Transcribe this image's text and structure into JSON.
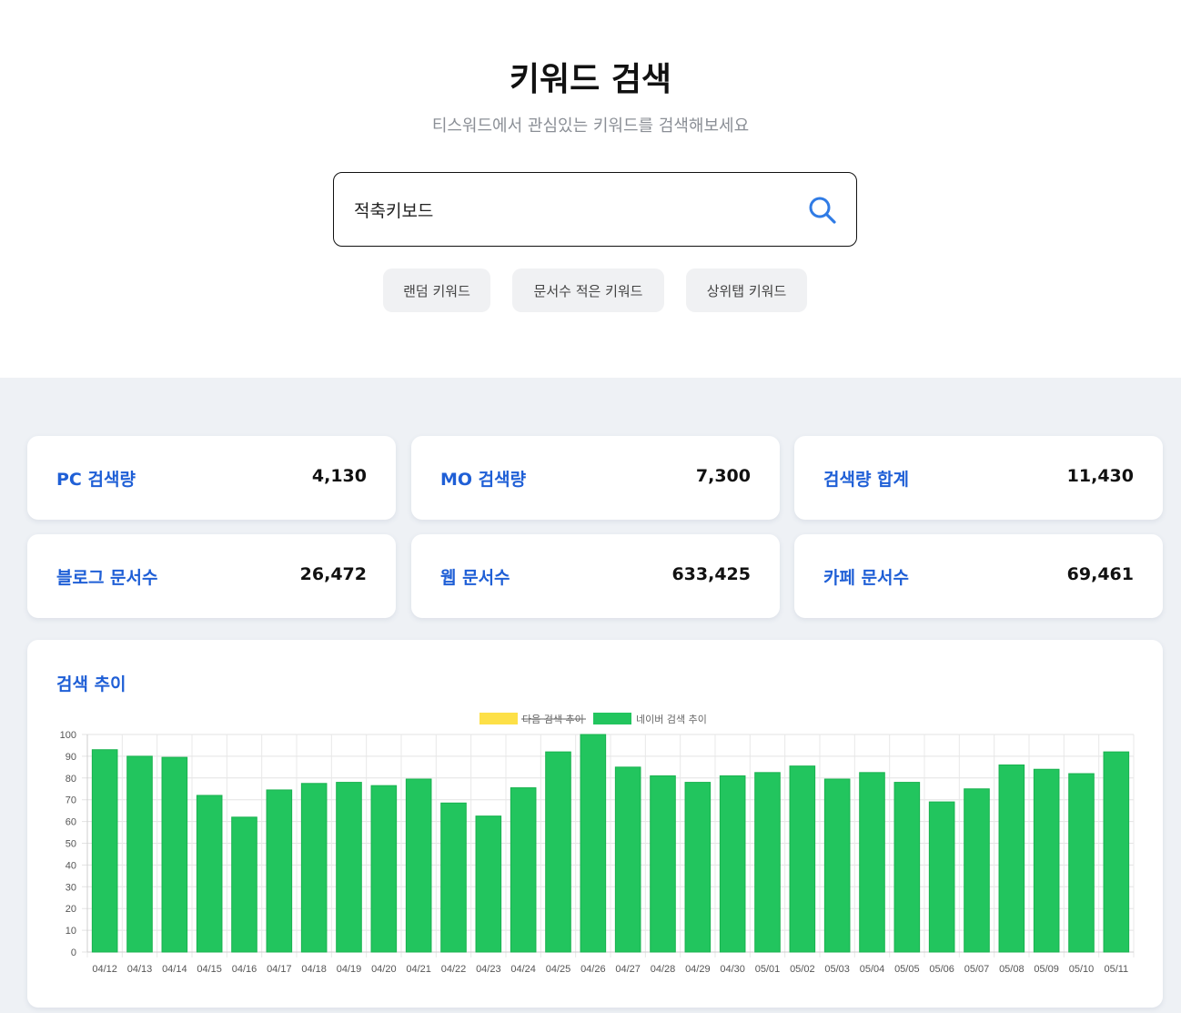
{
  "header": {
    "title": "키워드 검색",
    "subtitle": "티스워드에서 관심있는 키워드를 검색해보세요"
  },
  "search": {
    "value": "적축키보드",
    "placeholder": ""
  },
  "chips": [
    "랜덤 키워드",
    "문서수 적은 키워드",
    "상위탭 키워드"
  ],
  "stats": [
    {
      "label": "PC 검색량",
      "value": "4,130"
    },
    {
      "label": "MO 검색량",
      "value": "7,300"
    },
    {
      "label": "검색량 합계",
      "value": "11,430"
    },
    {
      "label": "블로그 문서수",
      "value": "26,472"
    },
    {
      "label": "웹 문서수",
      "value": "633,425"
    },
    {
      "label": "카페 문서수",
      "value": "69,461"
    }
  ],
  "colors": {
    "accent": "#1f5fd6",
    "search_icon": "#2f7be5",
    "daum_series": "#fde047",
    "naver_series": "#22c55e"
  },
  "chart_section": {
    "title": "검색 추이"
  },
  "chart_data": {
    "type": "bar",
    "categories": [
      "04/12",
      "04/13",
      "04/14",
      "04/15",
      "04/16",
      "04/17",
      "04/18",
      "04/19",
      "04/20",
      "04/21",
      "04/22",
      "04/23",
      "04/24",
      "04/25",
      "04/26",
      "04/27",
      "04/28",
      "04/29",
      "04/30",
      "05/01",
      "05/02",
      "05/03",
      "05/04",
      "05/05",
      "05/06",
      "05/07",
      "05/08",
      "05/09",
      "05/10",
      "05/11"
    ],
    "series": [
      {
        "name": "다음 검색 추이",
        "hidden": true,
        "values": []
      },
      {
        "name": "네이버 검색 추이",
        "values": [
          93,
          90,
          89.5,
          72,
          62,
          74.5,
          77.5,
          78,
          76.5,
          79.5,
          68.5,
          62.5,
          75.5,
          92,
          100,
          85,
          81,
          78,
          81,
          82.5,
          85.5,
          79.5,
          82.5,
          78,
          69,
          75,
          86,
          84,
          82,
          92
        ]
      }
    ],
    "ylim": [
      0,
      100
    ],
    "yticks": [
      0,
      10,
      20,
      30,
      40,
      50,
      60,
      70,
      80,
      90,
      100
    ],
    "grid": true,
    "legend": "top-center",
    "title": "",
    "xlabel": "",
    "ylabel": ""
  }
}
